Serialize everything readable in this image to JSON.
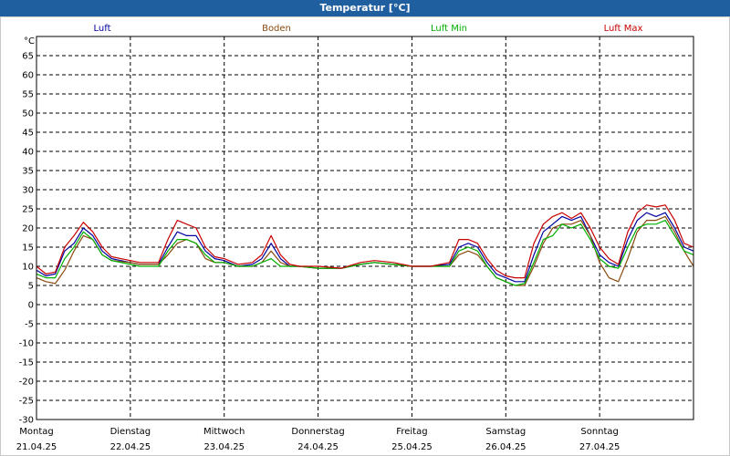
{
  "window": {
    "title": "Temperatur [°C]"
  },
  "chart_data": {
    "type": "line",
    "ylabel": "°C",
    "ylim": [
      -30,
      70
    ],
    "yticks": [
      65,
      60,
      55,
      50,
      45,
      40,
      35,
      30,
      25,
      20,
      15,
      10,
      5,
      0,
      -5,
      -10,
      -15,
      -20,
      -25,
      -30
    ],
    "xlim": [
      0,
      7
    ],
    "days": [
      {
        "weekday": "Montag",
        "date": "21.04.25"
      },
      {
        "weekday": "Dienstag",
        "date": "22.04.25"
      },
      {
        "weekday": "Mittwoch",
        "date": "23.04.25"
      },
      {
        "weekday": "Donnerstag",
        "date": "24.04.25"
      },
      {
        "weekday": "Freitag",
        "date": "25.04.25"
      },
      {
        "weekday": "Samstag",
        "date": "26.04.25"
      },
      {
        "weekday": "Sonntag",
        "date": "27.04.25"
      }
    ],
    "grid": true,
    "legend_position": "top",
    "series": [
      {
        "name": "Luft",
        "color": "#0000a0",
        "points": [
          [
            0,
            9
          ],
          [
            0.1,
            7.5
          ],
          [
            0.2,
            8
          ],
          [
            0.3,
            14
          ],
          [
            0.4,
            16
          ],
          [
            0.5,
            20
          ],
          [
            0.6,
            18
          ],
          [
            0.7,
            14
          ],
          [
            0.8,
            12
          ],
          [
            1,
            11
          ],
          [
            1.1,
            10.5
          ],
          [
            1.3,
            10.5
          ],
          [
            1.4,
            15
          ],
          [
            1.5,
            19
          ],
          [
            1.6,
            18
          ],
          [
            1.7,
            18
          ],
          [
            1.8,
            14
          ],
          [
            1.9,
            12
          ],
          [
            2,
            11.5
          ],
          [
            2.15,
            10
          ],
          [
            2.3,
            10.5
          ],
          [
            2.4,
            12
          ],
          [
            2.5,
            16
          ],
          [
            2.6,
            12
          ],
          [
            2.7,
            10
          ],
          [
            2.8,
            10
          ],
          [
            3,
            9.5
          ],
          [
            3.25,
            9.5
          ],
          [
            3.45,
            10.5
          ],
          [
            3.6,
            11
          ],
          [
            3.8,
            10.5
          ],
          [
            4,
            10
          ],
          [
            4.2,
            10
          ],
          [
            4.4,
            10.5
          ],
          [
            4.5,
            15
          ],
          [
            4.6,
            16
          ],
          [
            4.7,
            15
          ],
          [
            4.8,
            11
          ],
          [
            4.9,
            8
          ],
          [
            5,
            7
          ],
          [
            5.1,
            6
          ],
          [
            5.2,
            6
          ],
          [
            5.3,
            13
          ],
          [
            5.4,
            19
          ],
          [
            5.5,
            21
          ],
          [
            5.6,
            23
          ],
          [
            5.7,
            22
          ],
          [
            5.8,
            23
          ],
          [
            5.9,
            18
          ],
          [
            6,
            13
          ],
          [
            6.1,
            11
          ],
          [
            6.2,
            10
          ],
          [
            6.3,
            17
          ],
          [
            6.4,
            22
          ],
          [
            6.5,
            24
          ],
          [
            6.6,
            23
          ],
          [
            6.7,
            24
          ],
          [
            6.8,
            20
          ],
          [
            6.9,
            15
          ],
          [
            7,
            14
          ]
        ]
      },
      {
        "name": "Boden",
        "color": "#8b4a0e",
        "points": [
          [
            0,
            7
          ],
          [
            0.1,
            6
          ],
          [
            0.2,
            5.5
          ],
          [
            0.3,
            9
          ],
          [
            0.4,
            14
          ],
          [
            0.5,
            18
          ],
          [
            0.6,
            17
          ],
          [
            0.7,
            13
          ],
          [
            0.8,
            11.5
          ],
          [
            1,
            11
          ],
          [
            1.1,
            10.5
          ],
          [
            1.3,
            10.5
          ],
          [
            1.4,
            13
          ],
          [
            1.5,
            16
          ],
          [
            1.6,
            17
          ],
          [
            1.7,
            16
          ],
          [
            1.8,
            12
          ],
          [
            1.9,
            11
          ],
          [
            2,
            11
          ],
          [
            2.15,
            10
          ],
          [
            2.3,
            10
          ],
          [
            2.4,
            11
          ],
          [
            2.5,
            14
          ],
          [
            2.6,
            11
          ],
          [
            2.7,
            10
          ],
          [
            2.8,
            10
          ],
          [
            3,
            9.5
          ],
          [
            3.25,
            9.5
          ],
          [
            3.45,
            10.5
          ],
          [
            3.6,
            11
          ],
          [
            3.8,
            10.5
          ],
          [
            4,
            10
          ],
          [
            4.2,
            10
          ],
          [
            4.4,
            10
          ],
          [
            4.5,
            13
          ],
          [
            4.6,
            14
          ],
          [
            4.7,
            13
          ],
          [
            4.8,
            10
          ],
          [
            4.9,
            7
          ],
          [
            5,
            6
          ],
          [
            5.1,
            5
          ],
          [
            5.2,
            5
          ],
          [
            5.3,
            10
          ],
          [
            5.4,
            16
          ],
          [
            5.5,
            20
          ],
          [
            5.6,
            21
          ],
          [
            5.7,
            21
          ],
          [
            5.8,
            22
          ],
          [
            5.9,
            18
          ],
          [
            6,
            11
          ],
          [
            6.1,
            7
          ],
          [
            6.2,
            6
          ],
          [
            6.3,
            12
          ],
          [
            6.4,
            19
          ],
          [
            6.5,
            22
          ],
          [
            6.6,
            22
          ],
          [
            6.7,
            23
          ],
          [
            6.8,
            19
          ],
          [
            6.9,
            14
          ],
          [
            7,
            10
          ]
        ]
      },
      {
        "name": "Luft Min",
        "color": "#00b000",
        "points": [
          [
            0,
            8
          ],
          [
            0.1,
            7
          ],
          [
            0.2,
            7
          ],
          [
            0.3,
            12
          ],
          [
            0.4,
            15
          ],
          [
            0.5,
            19
          ],
          [
            0.6,
            17
          ],
          [
            0.7,
            13
          ],
          [
            0.8,
            11.5
          ],
          [
            1,
            10.5
          ],
          [
            1.1,
            10
          ],
          [
            1.3,
            10
          ],
          [
            1.4,
            14
          ],
          [
            1.5,
            17
          ],
          [
            1.6,
            17
          ],
          [
            1.7,
            16
          ],
          [
            1.8,
            13
          ],
          [
            1.9,
            11
          ],
          [
            2,
            11
          ],
          [
            2.15,
            10
          ],
          [
            2.3,
            10
          ],
          [
            2.4,
            11
          ],
          [
            2.5,
            12
          ],
          [
            2.6,
            10
          ],
          [
            2.7,
            10
          ],
          [
            2.8,
            10
          ],
          [
            3,
            9.5
          ],
          [
            3.25,
            9.5
          ],
          [
            3.45,
            10.5
          ],
          [
            3.6,
            11
          ],
          [
            3.8,
            10.5
          ],
          [
            4,
            10
          ],
          [
            4.2,
            10
          ],
          [
            4.4,
            10
          ],
          [
            4.5,
            14
          ],
          [
            4.6,
            15
          ],
          [
            4.7,
            14
          ],
          [
            4.8,
            10
          ],
          [
            4.9,
            7
          ],
          [
            5,
            6
          ],
          [
            5.1,
            5
          ],
          [
            5.2,
            5.5
          ],
          [
            5.3,
            11
          ],
          [
            5.4,
            17
          ],
          [
            5.5,
            18
          ],
          [
            5.6,
            21
          ],
          [
            5.7,
            20
          ],
          [
            5.8,
            21
          ],
          [
            5.9,
            17
          ],
          [
            6,
            12
          ],
          [
            6.1,
            10
          ],
          [
            6.2,
            9.5
          ],
          [
            6.3,
            15
          ],
          [
            6.4,
            20
          ],
          [
            6.5,
            21
          ],
          [
            6.6,
            21
          ],
          [
            6.7,
            22
          ],
          [
            6.8,
            18
          ],
          [
            6.9,
            14
          ],
          [
            7,
            13
          ]
        ]
      },
      {
        "name": "Luft Max",
        "color": "#c80000",
        "points": [
          [
            0,
            10
          ],
          [
            0.1,
            8
          ],
          [
            0.2,
            8.5
          ],
          [
            0.3,
            15
          ],
          [
            0.4,
            18
          ],
          [
            0.5,
            21.5
          ],
          [
            0.6,
            19
          ],
          [
            0.7,
            15
          ],
          [
            0.8,
            12.5
          ],
          [
            1,
            11.5
          ],
          [
            1.1,
            11
          ],
          [
            1.3,
            11
          ],
          [
            1.4,
            17
          ],
          [
            1.5,
            22
          ],
          [
            1.6,
            21
          ],
          [
            1.7,
            20
          ],
          [
            1.8,
            15
          ],
          [
            1.9,
            12.5
          ],
          [
            2,
            12
          ],
          [
            2.15,
            10.5
          ],
          [
            2.3,
            11
          ],
          [
            2.4,
            13
          ],
          [
            2.5,
            18
          ],
          [
            2.6,
            13
          ],
          [
            2.7,
            10.5
          ],
          [
            2.8,
            10
          ],
          [
            3,
            10
          ],
          [
            3.25,
            9.5
          ],
          [
            3.45,
            11
          ],
          [
            3.6,
            11.5
          ],
          [
            3.8,
            11
          ],
          [
            4,
            10
          ],
          [
            4.2,
            10
          ],
          [
            4.4,
            11
          ],
          [
            4.5,
            17
          ],
          [
            4.6,
            17
          ],
          [
            4.7,
            16
          ],
          [
            4.8,
            12
          ],
          [
            4.9,
            9
          ],
          [
            5,
            7.5
          ],
          [
            5.1,
            7
          ],
          [
            5.2,
            7
          ],
          [
            5.3,
            16
          ],
          [
            5.4,
            21
          ],
          [
            5.5,
            23
          ],
          [
            5.6,
            24
          ],
          [
            5.7,
            22.5
          ],
          [
            5.8,
            24
          ],
          [
            5.9,
            20
          ],
          [
            6,
            15
          ],
          [
            6.1,
            12
          ],
          [
            6.2,
            10.5
          ],
          [
            6.3,
            19
          ],
          [
            6.4,
            24
          ],
          [
            6.5,
            26
          ],
          [
            6.6,
            25.5
          ],
          [
            6.7,
            26
          ],
          [
            6.8,
            22
          ],
          [
            6.9,
            16
          ],
          [
            7,
            15
          ]
        ]
      }
    ]
  }
}
